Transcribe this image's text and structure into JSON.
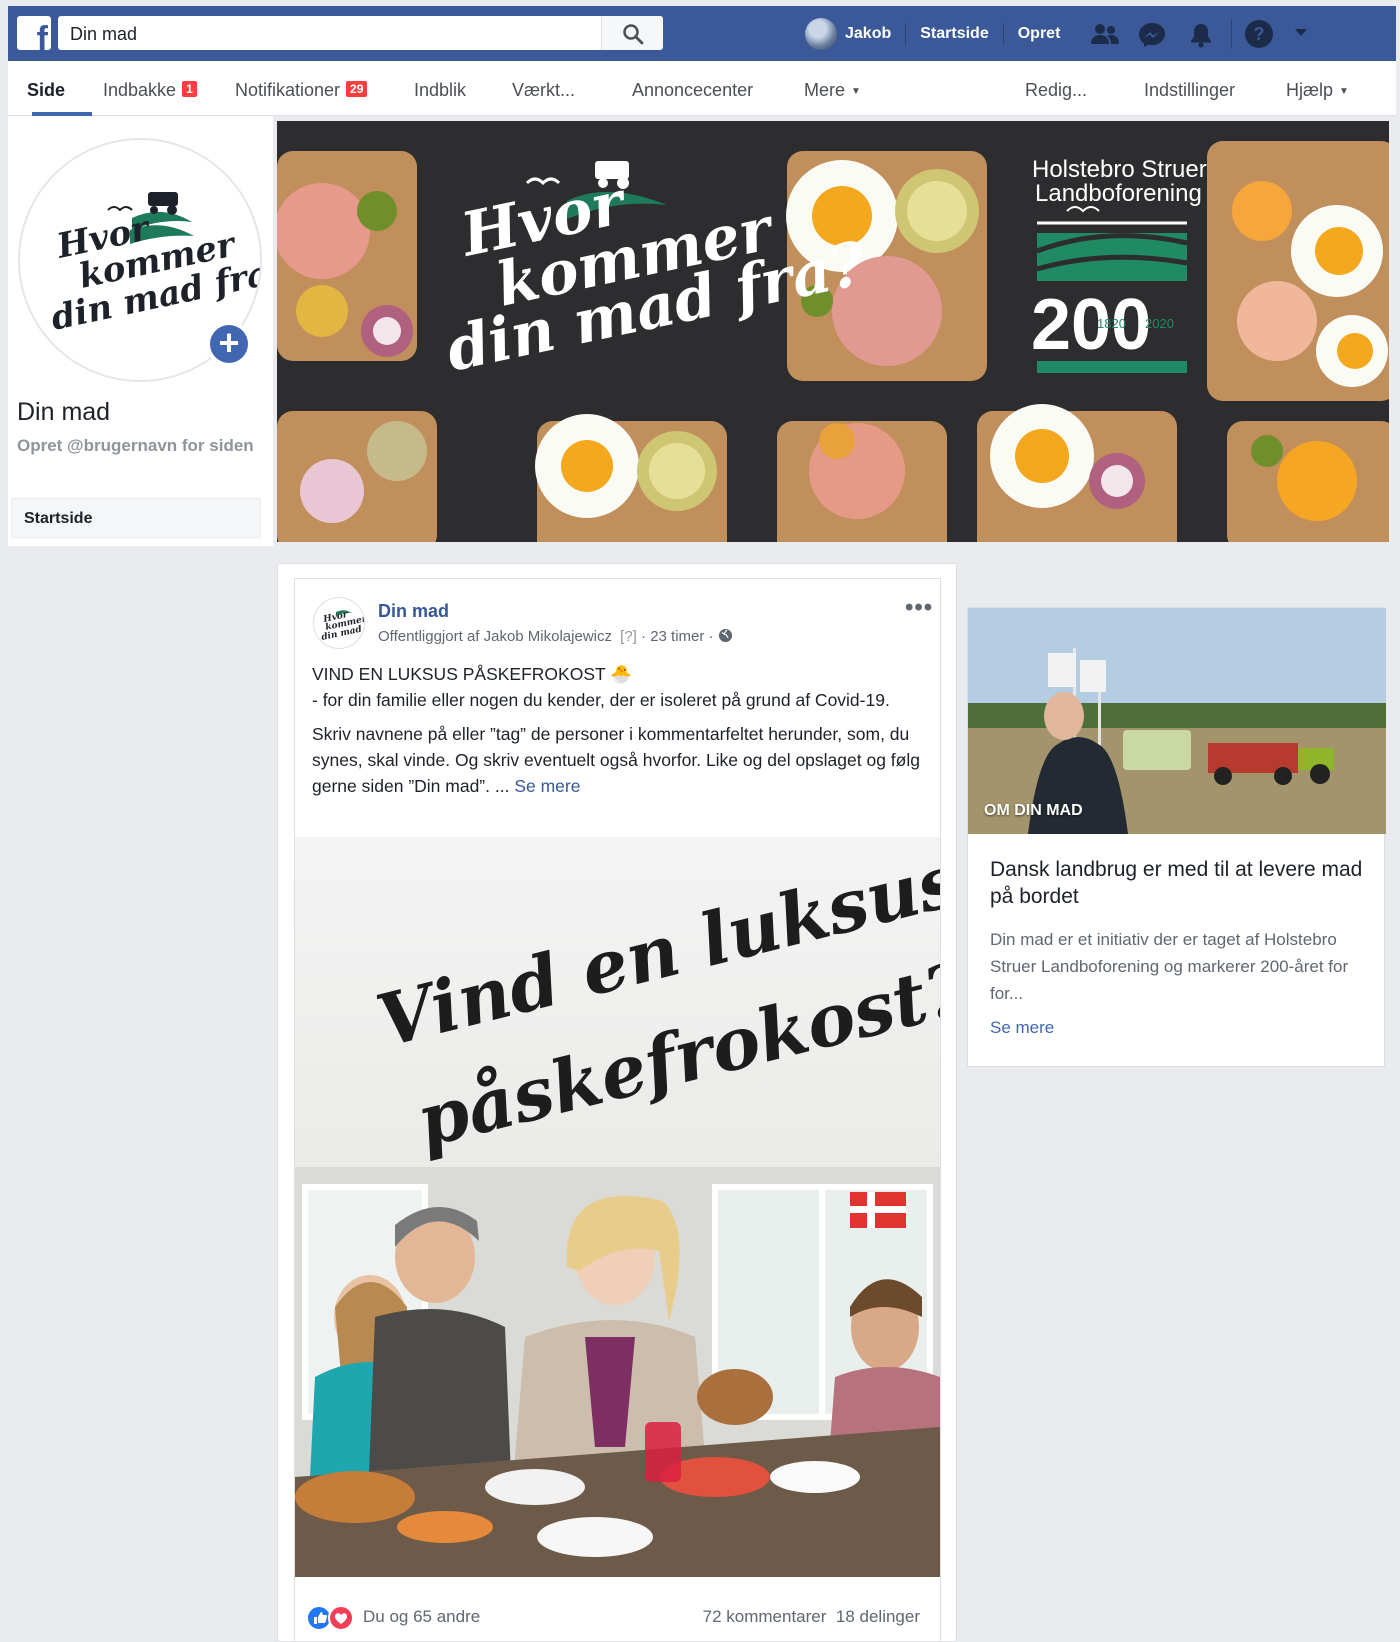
{
  "topbar": {
    "search_value": "Din mad",
    "user_name": "Jakob",
    "nav_home": "Startside",
    "nav_create": "Opret"
  },
  "subnav": {
    "items": [
      {
        "label": "Side"
      },
      {
        "label": "Indbakke",
        "badge": "1"
      },
      {
        "label": "Notifikationer",
        "badge": "29"
      },
      {
        "label": "Indblik"
      },
      {
        "label": "Værkt..."
      },
      {
        "label": "Annoncecenter"
      },
      {
        "label": "Mere"
      },
      {
        "label": "Redig..."
      },
      {
        "label": "Indstillinger"
      },
      {
        "label": "Hjælp"
      }
    ]
  },
  "page": {
    "logo_line1": "Hvor",
    "logo_line2": "kommer",
    "logo_line3": "din mad fra?",
    "name": "Din mad",
    "username_prompt": "Opret @brugernavn for siden",
    "side_nav_home": "Startside"
  },
  "cover": {
    "slogan_line1": "Hvor",
    "slogan_line2": "kommer",
    "slogan_line3": "din mad fra?",
    "org_line1": "Holstebro Struer",
    "org_line2": "Landboforening",
    "anniversary": "200",
    "year_start": "1820",
    "year_end": "2020"
  },
  "post": {
    "author": "Din mad",
    "published_by": "Offentliggjort af Jakob Mikolajewicz",
    "help_marker": "[?]",
    "time": "23 timer",
    "headline": "VIND EN LUKSUS PÅSKEFROKOST 🐣",
    "line2": "- for din familie eller nogen du kender, der er isoleret på grund af Covid-19.",
    "body": "Skriv navnene på eller ”tag” de personer i kommentarfeltet herunder, som, du synes, skal vinde. Og skriv eventuelt også hvorfor. Like og del opslaget og følg gerne siden ”Din mad”. ...",
    "see_more": "Se mere",
    "image_line1": "Vind en luksus",
    "image_line2": "påskefrokost?",
    "reactions_text": "Du og 65 andre",
    "comments": "72 kommentarer",
    "shares": "18 delinger"
  },
  "about": {
    "label": "OM DIN MAD",
    "title": "Dansk landbrug er med til at levere mad på bordet",
    "description": "Din mad er et initiativ der er taget af Holstebro Struer Landboforening og markerer 200-året for for...",
    "see_more": "Se mere"
  },
  "colors": {
    "facebook_blue": "#3b5998",
    "link_blue": "#365899",
    "brand_green": "#1f7a5c",
    "badge_red": "#fa3e3e"
  }
}
